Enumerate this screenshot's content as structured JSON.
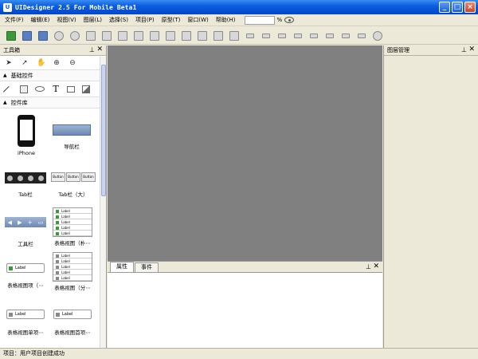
{
  "window": {
    "title": "UIDesigner 2.5 For Mobile Beta1",
    "minimize": "_",
    "maximize": "□",
    "close": "×"
  },
  "menu": [
    "文件(F)",
    "编辑(E)",
    "视图(V)",
    "图层(L)",
    "选择(S)",
    "项目(P)",
    "原型(T)",
    "窗口(W)",
    "帮助(H)"
  ],
  "zoom": {
    "value": "",
    "unit": "%"
  },
  "toolbar_icons": [
    "new-icon",
    "save-icon",
    "save-all-icon",
    "undo-icon",
    "redo-icon",
    "cut-icon",
    "copy-icon",
    "paste-icon",
    "image-icon",
    "group-icon",
    "ungroup-icon",
    "bring-front-icon",
    "send-back-icon",
    "bring-forward-icon",
    "send-backward-icon",
    "align-left-icon",
    "align-center-icon",
    "align-right-icon",
    "align-top-icon",
    "align-middle-icon",
    "align-bottom-icon",
    "distribute-h-icon",
    "distribute-v-icon",
    "play-icon"
  ],
  "toolbox": {
    "title": "工具箱",
    "pin": "⊥",
    "close": "✕",
    "section_basic": "基础控件",
    "section_controls": "控件库",
    "items": [
      {
        "label": "iPhone"
      },
      {
        "label": "导航栏"
      },
      {
        "label": "Tab栏"
      },
      {
        "label": "Tab栏（大）"
      },
      {
        "label": "工具栏"
      },
      {
        "label": "表格视图（朴⋯"
      },
      {
        "label": "表格视图项（⋯"
      },
      {
        "label": "表格视图（分⋯"
      },
      {
        "label": "表格视图单项⋯"
      },
      {
        "label": "表格视图首项⋯"
      }
    ],
    "button_text": "Button",
    "cell_text": "Label"
  },
  "properties": {
    "tabs": [
      "属性",
      "事件"
    ],
    "pin": "⊥",
    "close": "✕"
  },
  "layers": {
    "title": "图层管理",
    "pin": "⊥",
    "close": "✕"
  },
  "status": "项目：用户项目创建成功"
}
